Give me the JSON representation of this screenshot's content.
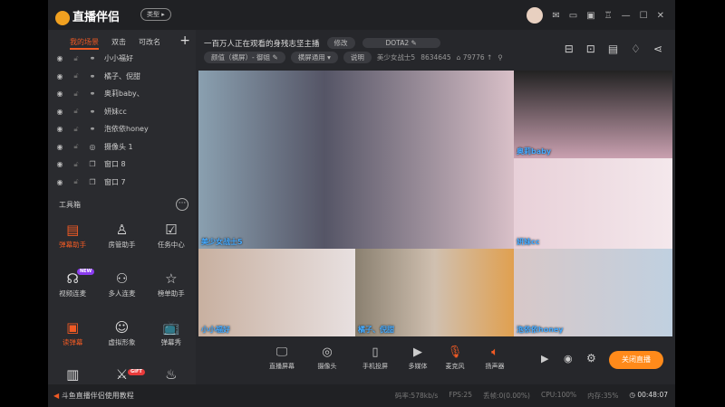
{
  "app": {
    "title": "直播伴侣",
    "type_button": "类型 ▸"
  },
  "titlebar_icons": [
    "mail-icon",
    "message-icon",
    "save-icon",
    "shirt-icon",
    "minimize-icon",
    "maximize-icon",
    "close-icon"
  ],
  "sidebar": {
    "tabs": [
      "我的场景",
      "双击",
      "可改名"
    ],
    "scenes": [
      {
        "type": "link",
        "label": "小小福好"
      },
      {
        "type": "link",
        "label": "橘子、倪甜"
      },
      {
        "type": "link",
        "label": "奥莉baby、"
      },
      {
        "type": "link",
        "label": "妍妹cc"
      },
      {
        "type": "link",
        "label": "泡依依honey"
      },
      {
        "type": "camera",
        "label": "摄像头 1"
      },
      {
        "type": "window",
        "label": "窗口 8"
      },
      {
        "type": "window",
        "label": "窗口 7"
      }
    ],
    "toolbox_title": "工具箱",
    "tools": [
      {
        "label": "弹幕助手",
        "icon": "▤",
        "orange": true
      },
      {
        "label": "房管助手",
        "icon": "♙",
        "orange": false
      },
      {
        "label": "任务中心",
        "icon": "☑",
        "orange": false
      },
      {
        "label": "视频连麦",
        "icon": "☊",
        "orange": false
      },
      {
        "label": "多人连麦",
        "icon": "⚇",
        "orange": false
      },
      {
        "label": "榜单助手",
        "icon": "☆",
        "orange": false
      },
      {
        "label": "读弹幕",
        "icon": "▣",
        "orange": true
      },
      {
        "label": "虚拟形象",
        "icon": "☺",
        "orange": false
      },
      {
        "label": "弹幕秀",
        "icon": "📺",
        "orange": false
      }
    ],
    "tool_badge_new": "NEW",
    "tool_badge_gift": "GIFT"
  },
  "stream": {
    "title": "一百万人正在观看的身残志坚主播",
    "edit": "修改",
    "game": "DOTA2",
    "category": "颜值（横屏）- 御姐",
    "orientation": "横屏通用",
    "explain": "说明",
    "streamer": "美少女战士5",
    "room_id": "8634645",
    "popularity": "79776"
  },
  "video_labels": [
    "美少女战士5",
    "奥莉baby",
    "妍妹cc",
    "小小福好",
    "橘子、倪甜",
    "泡依依honey"
  ],
  "controls": [
    "直播屏幕",
    "摄像头",
    "手机投屏",
    "多媒体",
    "麦克风",
    "扬声器"
  ],
  "stop_button": "关闭直播",
  "footer": {
    "help": "斗鱼直播伴侣使用教程",
    "bitrate": "码率:578kb/s",
    "fps": "FPS:25",
    "dropped": "丢帧:0(0.00%)",
    "cpu": "CPU:100%",
    "memory": "内存:35%",
    "time": "00:48:07"
  }
}
